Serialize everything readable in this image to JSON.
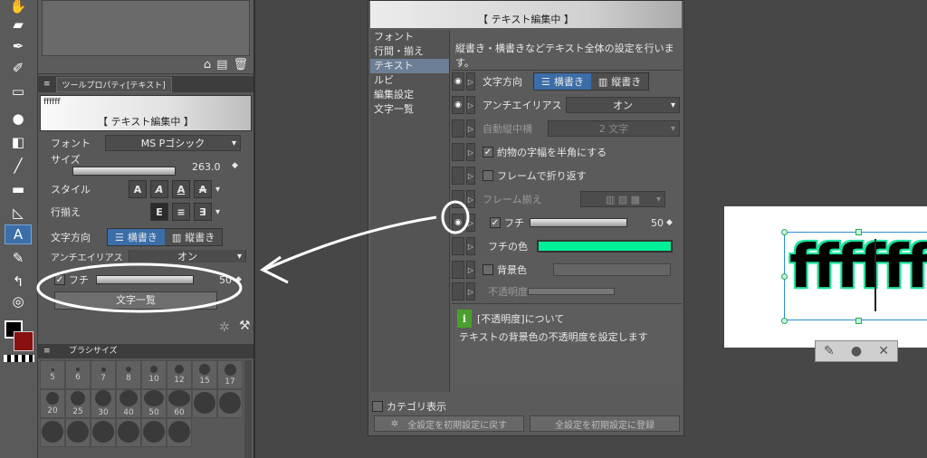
{
  "colors": {
    "accent": "#3b6ea8",
    "stroke_color": "#00f09a",
    "annotation": "#ffffff"
  },
  "tool_panel": {
    "tab_label": "ツールプロパティ[テキスト]",
    "preview_small": "ffffff",
    "preview_caption": "【 テキスト編集中 】",
    "font_label": "フォント",
    "font_value": "MS Pゴシック",
    "size_label": "サイズ",
    "size_value": "263.0",
    "style_label": "スタイル",
    "align_label": "行揃え",
    "direction_label": "文字方向",
    "horizontal_label": "横書き",
    "vertical_label": "縦書き",
    "antialias_label": "アンチエイリアス",
    "antialias_value": "オン",
    "stroke_label": "フチ",
    "stroke_value": "50",
    "list_button": "文字一覧",
    "brush_tab": "ブラシサイズ",
    "brush_sizes": [
      "5",
      "6",
      "7",
      "8",
      "10",
      "12",
      "15",
      "17",
      "20",
      "25",
      "30",
      "40",
      "50",
      "60",
      "",
      "",
      "",
      "",
      "",
      "",
      "",
      "",
      ""
    ]
  },
  "dialog": {
    "preview_caption": "【 テキスト編集中 】",
    "categories": [
      "フォント",
      "行間・揃え",
      "テキスト",
      "ルビ",
      "編集設定",
      "文字一覧"
    ],
    "description": "縦書き・横書きなどテキスト全体の設定を行います。",
    "rows": {
      "direction_label": "文字方向",
      "horizontal": "横書き",
      "vertical": "縦書き",
      "antialias_label": "アンチエイリアス",
      "antialias_value": "オン",
      "auto_tcy_label": "自動縦中横",
      "auto_tcy_value": "2 文字",
      "halfwidth_label": "約物の字幅を半角にする",
      "wrap_label": "フレームで折り返す",
      "frame_align_label": "フレーム揃え",
      "stroke_label": "フチ",
      "stroke_value": "50",
      "stroke_color_label": "フチの色",
      "bg_color_label": "背景色",
      "opacity_label": "不透明度"
    },
    "info_title": "[不透明度]について",
    "info_body": "テキストの背景色の不透明度を設定します",
    "category_display": "カテゴリ表示",
    "reset_button": "全設定を初期設定に戻す",
    "register_button": "全設定を初期設定に登録"
  },
  "canvas": {
    "text": "ffffff"
  }
}
